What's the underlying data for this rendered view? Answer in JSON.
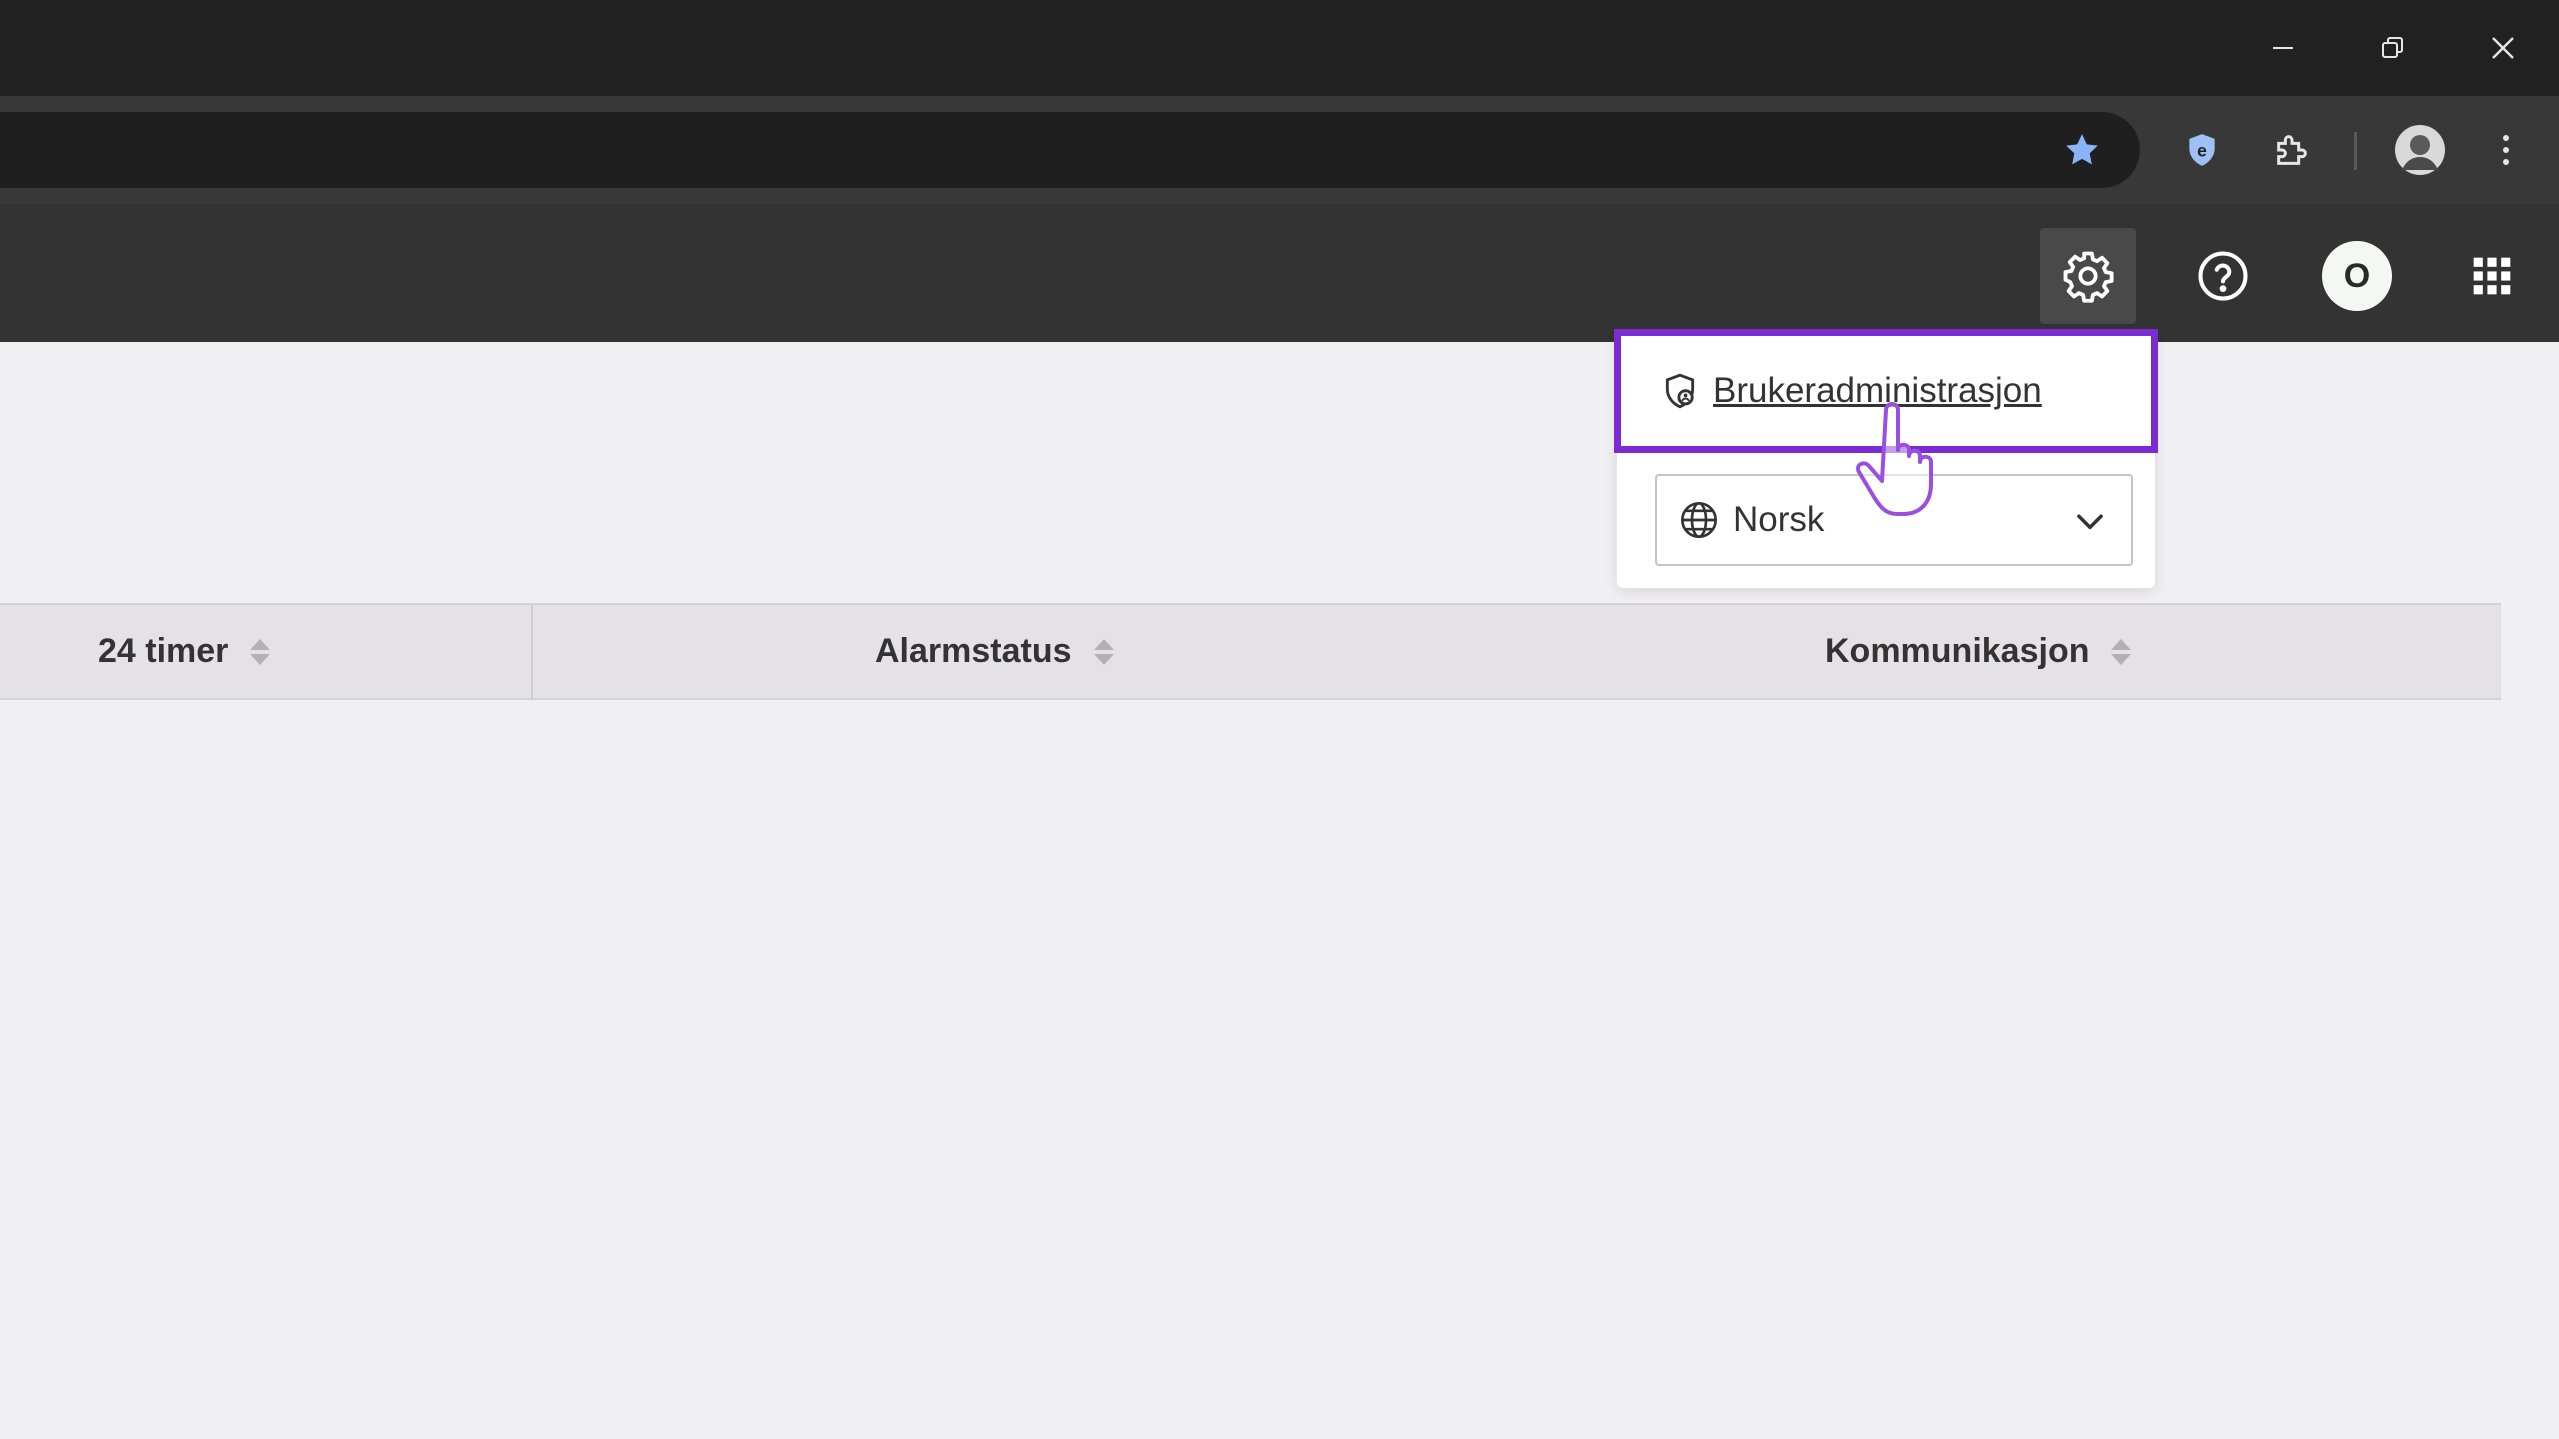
{
  "browser": {
    "window_controls": {
      "minimize_icon": "minimize-icon",
      "restore_icon": "restore-icon",
      "close_icon": "close-icon"
    },
    "toolbar_icons": [
      "bookmark-star-icon",
      "shield-extension-icon",
      "extensions-puzzle-icon",
      "profile-avatar-icon",
      "kebab-menu-icon"
    ],
    "bookmark_star_color": "#8ab4f8"
  },
  "appbar": {
    "settings_icon": "gear-icon",
    "help_icon": "help-icon",
    "avatar_initial": "O",
    "apps_icon": "apps-grid-icon"
  },
  "settings_menu": {
    "user_admin_label": "Brukeradministrasjon",
    "language_selected": "Norsk",
    "highlight_color": "#7a2bd2"
  },
  "table": {
    "columns": [
      {
        "label": "24 timer"
      },
      {
        "label": "Alarmstatus"
      },
      {
        "label": "Kommunikasjon"
      }
    ]
  }
}
